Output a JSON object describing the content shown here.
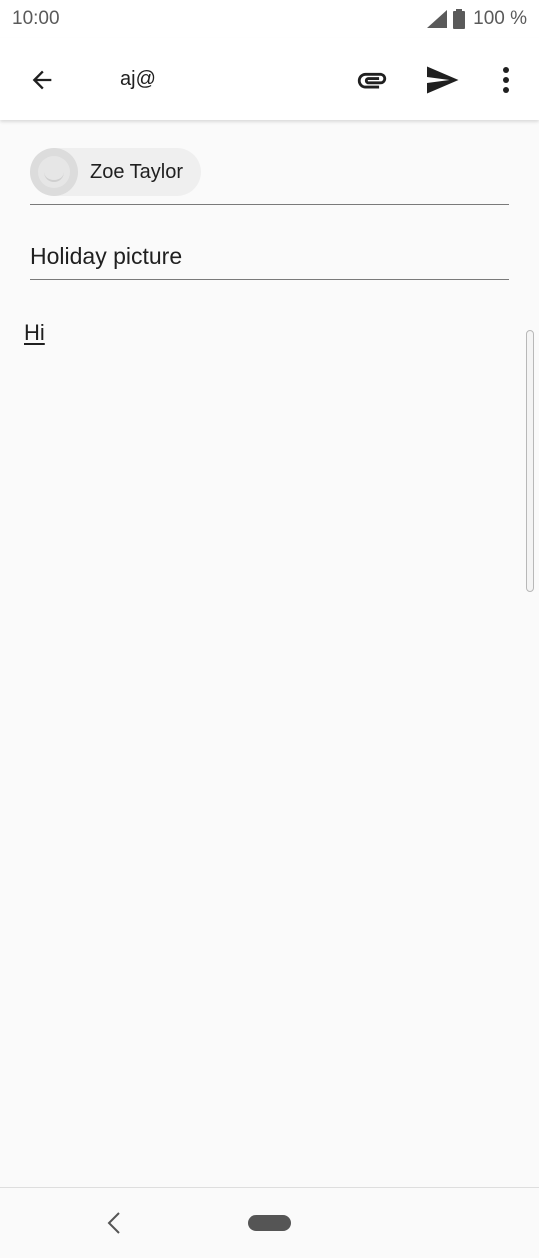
{
  "status_bar": {
    "time": "10:00",
    "battery": "100 %",
    "icons": [
      "signal-icon",
      "battery-icon"
    ]
  },
  "toolbar": {
    "title": "aj@",
    "icons": [
      "arrow-back-icon",
      "paperclip-icon",
      "send-icon",
      "more-vert-icon"
    ]
  },
  "compose": {
    "recipient": {
      "name": "Zoe Taylor",
      "icon": "avatar-icon"
    },
    "subject": "Holiday picture",
    "body": "Hi"
  },
  "nav_bar": {
    "icons": [
      "nav-back-icon",
      "home-pill-icon"
    ]
  },
  "colors": {
    "background": "#fafafa",
    "toolbar": "#ffffff",
    "text": "#202020",
    "divider": "#7a7a7a"
  }
}
